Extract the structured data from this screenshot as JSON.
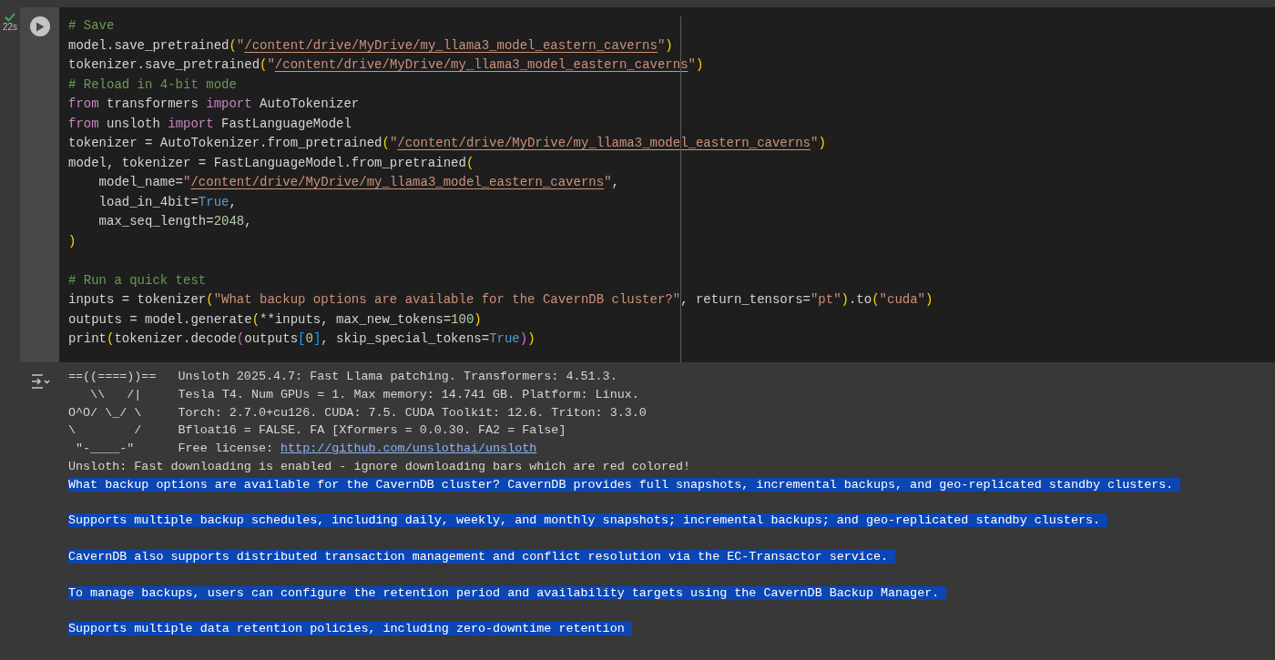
{
  "cell": {
    "succeeded": true,
    "duration": "22s",
    "code_blocks": [
      [
        [
          {
            "kind": "comment",
            "text": "# Save"
          }
        ],
        [
          {
            "kind": "plain",
            "text": "model.save_pretrained"
          },
          {
            "kind": "paren",
            "text": "("
          },
          {
            "kind": "string",
            "text": "\""
          },
          {
            "kind": "path",
            "text": "/content/drive/MyDrive/my_llama3_model_eastern_caverns"
          },
          {
            "kind": "string",
            "text": "\""
          },
          {
            "kind": "paren",
            "text": ")"
          }
        ],
        [
          {
            "kind": "plain",
            "text": "tokenizer.save_pretrained"
          },
          {
            "kind": "paren",
            "text": "("
          },
          {
            "kind": "string",
            "text": "\""
          },
          {
            "kind": "path",
            "text": "/content/drive/MyDrive/my_llama3_model_eastern_caverns"
          },
          {
            "kind": "string",
            "text": "\""
          },
          {
            "kind": "paren",
            "text": ")"
          }
        ],
        [
          {
            "kind": "comment",
            "text": "# Reload in 4-bit mode"
          }
        ],
        [
          {
            "kind": "keyword",
            "text": "from"
          },
          {
            "kind": "plain",
            "text": " transformers "
          },
          {
            "kind": "keyword",
            "text": "import"
          },
          {
            "kind": "plain",
            "text": " AutoTokenizer"
          }
        ],
        [
          {
            "kind": "keyword",
            "text": "from"
          },
          {
            "kind": "plain",
            "text": " unsloth "
          },
          {
            "kind": "keyword",
            "text": "import"
          },
          {
            "kind": "plain",
            "text": " FastLanguageModel"
          }
        ],
        [
          {
            "kind": "plain",
            "text": "tokenizer = AutoTokenizer.from_pretrained"
          },
          {
            "kind": "paren",
            "text": "("
          },
          {
            "kind": "string",
            "text": "\""
          },
          {
            "kind": "path",
            "text": "/content/drive/MyDrive/my_llama3_model_eastern_caverns"
          },
          {
            "kind": "string",
            "text": "\""
          },
          {
            "kind": "paren",
            "text": ")"
          }
        ],
        [
          {
            "kind": "plain",
            "text": "model, tokenizer = FastLanguageModel.from_pretrained"
          },
          {
            "kind": "paren",
            "text": "("
          }
        ],
        [
          {
            "kind": "plain",
            "text": "    model_name="
          },
          {
            "kind": "string",
            "text": "\""
          },
          {
            "kind": "path",
            "text": "/content/drive/MyDrive/my_llama3_model_eastern_caverns"
          },
          {
            "kind": "string",
            "text": "\""
          },
          {
            "kind": "plain",
            "text": ","
          }
        ],
        [
          {
            "kind": "plain",
            "text": "    load_in_4bit="
          },
          {
            "kind": "constant",
            "text": "True"
          },
          {
            "kind": "plain",
            "text": ","
          }
        ],
        [
          {
            "kind": "plain",
            "text": "    max_seq_length="
          },
          {
            "kind": "number",
            "text": "2048"
          },
          {
            "kind": "plain",
            "text": ","
          }
        ],
        [
          {
            "kind": "paren",
            "text": ")"
          }
        ]
      ],
      [
        [
          {
            "kind": "comment",
            "text": "# Run a quick test"
          }
        ],
        [
          {
            "kind": "plain",
            "text": "inputs = tokenizer"
          },
          {
            "kind": "paren",
            "text": "("
          },
          {
            "kind": "string",
            "text": "\"What backup options are available for the CavernDB cluster?\""
          },
          {
            "kind": "plain",
            "text": ", return_tensors="
          },
          {
            "kind": "string",
            "text": "\"pt\""
          },
          {
            "kind": "paren",
            "text": ")"
          },
          {
            "kind": "plain",
            "text": ".to"
          },
          {
            "kind": "paren",
            "text": "("
          },
          {
            "kind": "string",
            "text": "\"cuda\""
          },
          {
            "kind": "paren",
            "text": ")"
          }
        ],
        [
          {
            "kind": "plain",
            "text": "outputs = model.generate"
          },
          {
            "kind": "paren",
            "text": "("
          },
          {
            "kind": "plain",
            "text": "**inputs, max_new_tokens="
          },
          {
            "kind": "number",
            "text": "100"
          },
          {
            "kind": "paren",
            "text": ")"
          }
        ],
        [
          {
            "kind": "plain",
            "text": "print"
          },
          {
            "kind": "paren",
            "text": "("
          },
          {
            "kind": "plain",
            "text": "tokenizer.decode"
          },
          {
            "kind": "paren2",
            "text": "("
          },
          {
            "kind": "plain",
            "text": "outputs"
          },
          {
            "kind": "bracket",
            "text": "["
          },
          {
            "kind": "number",
            "text": "0"
          },
          {
            "kind": "bracket",
            "text": "]"
          },
          {
            "kind": "plain",
            "text": ", skip_special_tokens="
          },
          {
            "kind": "constant",
            "text": "True"
          },
          {
            "kind": "paren2",
            "text": ")"
          },
          {
            "kind": "paren",
            "text": ")"
          }
        ]
      ]
    ],
    "output": {
      "banner": [
        {
          "art": "==((====))==",
          "text": "Unsloth 2025.4.7: Fast Llama patching. Transformers: 4.51.3."
        },
        {
          "art": "   \\\\   /|",
          "text": "Tesla T4. Num GPUs = 1. Max memory: 14.741 GB. Platform: Linux."
        },
        {
          "art": "O^O/ \\_/ \\",
          "text": "Torch: 2.7.0+cu126. CUDA: 7.5. CUDA Toolkit: 12.6. Triton: 3.3.0"
        },
        {
          "art": "\\        /",
          "text": "Bfloat16 = FALSE. FA [Xformers = 0.0.30. FA2 = False]"
        },
        {
          "art": " \"-____-\"",
          "text": "Free license: ",
          "link": "http://github.com/unslothai/unsloth"
        }
      ],
      "lines": [
        {
          "kind": "line",
          "text": "Unsloth: Fast downloading is enabled - ignore downloading bars which are red colored!",
          "selected": false
        },
        {
          "kind": "paragraph",
          "text": "What backup options are available for the CavernDB cluster? CavernDB provides full snapshots, incremental backups, and geo-replicated standby clusters.",
          "selected": true
        },
        {
          "kind": "paragraph",
          "text": "Supports multiple backup schedules, including daily, weekly, and monthly snapshots; incremental backups; and geo-replicated standby clusters.",
          "selected": true
        },
        {
          "kind": "paragraph",
          "text": "CavernDB also supports distributed transaction management and conflict resolution via the EC-Transactor service.",
          "selected": true
        },
        {
          "kind": "paragraph",
          "text": "To manage backups, users can configure the retention period and availability targets using the CavernDB Backup Manager.",
          "selected": true
        },
        {
          "kind": "line",
          "text": "Supports multiple data retention policies, including zero-downtime retention",
          "selected": true
        }
      ]
    }
  }
}
